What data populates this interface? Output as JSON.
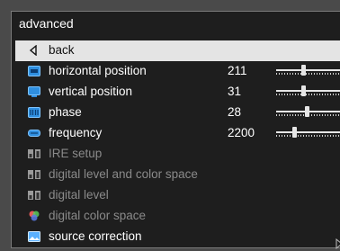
{
  "menu": {
    "title": "advanced",
    "items": [
      {
        "label": "back",
        "icon": "back-arrow-icon",
        "selected": true,
        "disabled": false
      },
      {
        "label": "horizontal position",
        "icon": "horizontal-position-icon",
        "value": "211",
        "slider": 0.4,
        "disabled": false
      },
      {
        "label": "vertical position",
        "icon": "vertical-position-icon",
        "value": "31",
        "slider": 0.4,
        "disabled": false
      },
      {
        "label": "phase",
        "icon": "phase-icon",
        "value": "28",
        "slider": 0.45,
        "disabled": false
      },
      {
        "label": "frequency",
        "icon": "frequency-icon",
        "value": "2200",
        "slider": 0.25,
        "disabled": false
      },
      {
        "label": "IRE setup",
        "icon": "ire-setup-icon",
        "disabled": true
      },
      {
        "label": "digital level and color space",
        "icon": "digital-level-color-space-icon",
        "disabled": true
      },
      {
        "label": "digital level",
        "icon": "digital-level-icon",
        "disabled": true
      },
      {
        "label": "digital color space",
        "icon": "digital-color-space-icon",
        "disabled": true
      },
      {
        "label": "source correction",
        "icon": "source-correction-icon",
        "disabled": false
      }
    ]
  },
  "colors": {
    "background": "#1e1e1e",
    "selected": "#e4e4e4",
    "icon_blue": "#2f8fe0",
    "disabled_text": "#8a8a8a"
  }
}
